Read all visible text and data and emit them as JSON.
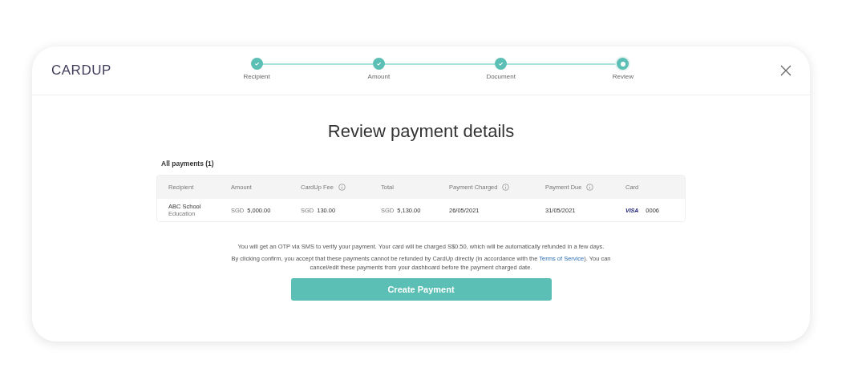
{
  "logo": "CARDUP",
  "steps": [
    {
      "label": "Recipient",
      "completed": true,
      "selected": false
    },
    {
      "label": "Amount",
      "completed": true,
      "selected": false
    },
    {
      "label": "Document",
      "completed": true,
      "selected": false
    },
    {
      "label": "Review",
      "completed": false,
      "selected": true
    }
  ],
  "title": "Review payment details",
  "section_label": "All payments (1)",
  "table": {
    "columns": [
      {
        "label": "Recipient",
        "info": false
      },
      {
        "label": "Amount",
        "info": false
      },
      {
        "label": "CardUp Fee",
        "info": true
      },
      {
        "label": "Total",
        "info": false
      },
      {
        "label": "Payment Charged",
        "info": true
      },
      {
        "label": "Payment Due",
        "info": true
      },
      {
        "label": "Card",
        "info": false
      }
    ],
    "rows": [
      {
        "recipient": "ABC School",
        "category": "Education",
        "amount_currency": "SGD",
        "amount": "5,000.00",
        "fee_currency": "SGD",
        "fee": "130.00",
        "total_currency": "SGD",
        "total": "5,130.00",
        "charged": "26/05/2021",
        "due": "31/05/2021",
        "card_brand": "VISA",
        "card_last4": "0006"
      }
    ]
  },
  "notice": "You will get an OTP via SMS to verify your payment. Your card will be charged S$0.50, which will be automatically refunded in a few days.",
  "terms": {
    "before": "By clicking confirm, you accept that these payments cannot be refunded by CardUp directly (in accordance with the",
    "link": "Terms of Service",
    "after": "). You can cancel/edit these payments from your dashboard before the payment charged date."
  },
  "button": "Create Payment"
}
